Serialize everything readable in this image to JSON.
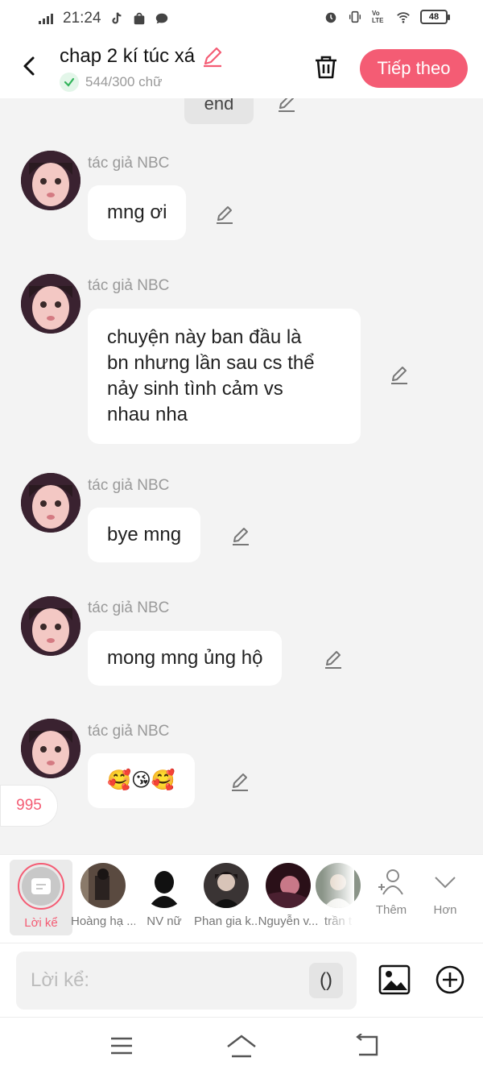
{
  "status_bar": {
    "time": "21:24",
    "battery": "48",
    "volte": "Vo LTE"
  },
  "header": {
    "title": "chap 2 kí túc xá",
    "word_count": "544/300 chữ",
    "next_button": "Tiếp theo",
    "accent_color": "#f45c74"
  },
  "chat": {
    "previous_message": "end",
    "messages": [
      {
        "author": "tác giả NBC",
        "text": "mng ơi"
      },
      {
        "author": "tác giả NBC",
        "lines": [
          "chuyện này ban đầu là",
          "bn nhưng lần sau cs thể",
          "nảy sinh tình cảm vs",
          "nhau nha"
        ]
      },
      {
        "author": "tác giả NBC",
        "text": "bye mng"
      },
      {
        "author": "tác giả NBC",
        "text": "mong mng ủng hộ"
      },
      {
        "author": "tác giả NBC",
        "text": "🥰😘🥰"
      }
    ],
    "counter": "995"
  },
  "characters": {
    "narrator": "Lời kể",
    "items": [
      "Hoàng hạ ...",
      "NV nữ",
      "Phan gia k...",
      "Nguyễn v...",
      "trần t"
    ],
    "add_label": "Thêm",
    "more_label": "Hơn"
  },
  "input": {
    "placeholder": "Lời kể:",
    "paren": "()"
  },
  "icons": [
    "back-icon",
    "edit-icon",
    "check-icon",
    "trash-icon",
    "pencil-icon",
    "narration-icon",
    "add-person-icon",
    "chevron-down-icon",
    "image-icon",
    "plus-circle-icon",
    "menu-icon",
    "home-icon",
    "back-nav-icon"
  ]
}
